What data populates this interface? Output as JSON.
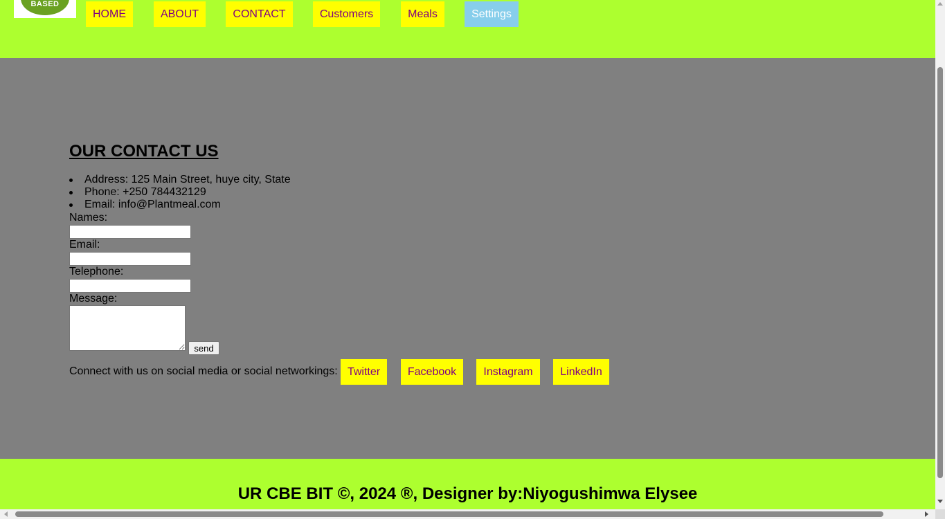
{
  "logo": {
    "text": "BASED",
    "icon": "plant-based-logo"
  },
  "nav": {
    "home": "HOME",
    "about": "ABOUT",
    "contact": "CONTACT",
    "customers": "Customers",
    "meals": "Meals",
    "settings": "Settings"
  },
  "contact": {
    "title": "OUR CONTACT US",
    "address": "Address: 125 Main Street, huye city, State",
    "phone": "Phone: +250 784432129",
    "email": "Email: info@Plantmeal.com"
  },
  "form": {
    "names_label": "Names:",
    "names_value": "",
    "email_label": "Email:",
    "email_value": "",
    "telephone_label": "Telephone:",
    "telephone_value": "",
    "message_label": "Message:",
    "message_value": "",
    "send_label": "send"
  },
  "social": {
    "text": "Connect with us on social media or social networkings:",
    "twitter": "Twitter",
    "facebook": "Facebook",
    "instagram": "Instagram",
    "linkedin": "LinkedIn"
  },
  "footer": {
    "text": "UR CBE BIT ©, 2024 ®, Designer by:Niyogushimwa Elysee"
  },
  "colors": {
    "header_bg": "#adff2f",
    "main_bg": "#808080",
    "link_bg": "#ffff00",
    "link_text": "#800080",
    "settings_bg": "#87ceeb"
  }
}
